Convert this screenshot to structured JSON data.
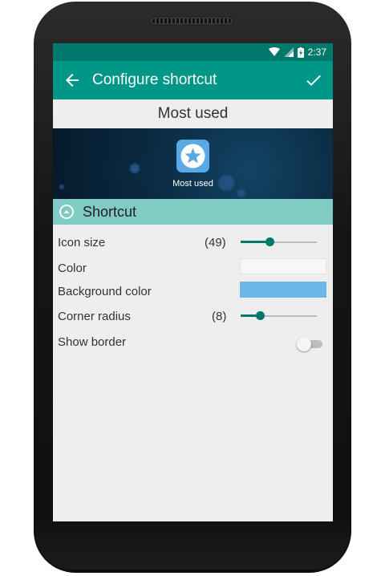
{
  "status_bar": {
    "time": "2:37",
    "icons": [
      "wifi-icon",
      "signal-icon",
      "battery-charging-icon"
    ]
  },
  "app_bar": {
    "title": "Configure shortcut",
    "back_icon": "arrow-back-icon",
    "confirm_icon": "check-icon"
  },
  "preview": {
    "label": "Most used",
    "shortcut_label": "Most used",
    "shortcut_icon": "star-icon",
    "shortcut_color": "#5aa8e4"
  },
  "section": {
    "title": "Shortcut",
    "icon": "chevron-up-circle-icon"
  },
  "settings": {
    "icon_size": {
      "label": "Icon size",
      "value_text": "(49)",
      "level": 0.38
    },
    "color": {
      "label": "Color",
      "value": "#f7f7f7"
    },
    "background_color": {
      "label": "Background color",
      "value": "#6ab8e6"
    },
    "corner_radius": {
      "label": "Corner radius",
      "value_text": "(8)",
      "level": 0.25
    },
    "show_border": {
      "label": "Show border",
      "on": false
    }
  },
  "colors": {
    "primary": "#009688",
    "primary_dark": "#00796b",
    "accent_section": "#80cbc4"
  }
}
